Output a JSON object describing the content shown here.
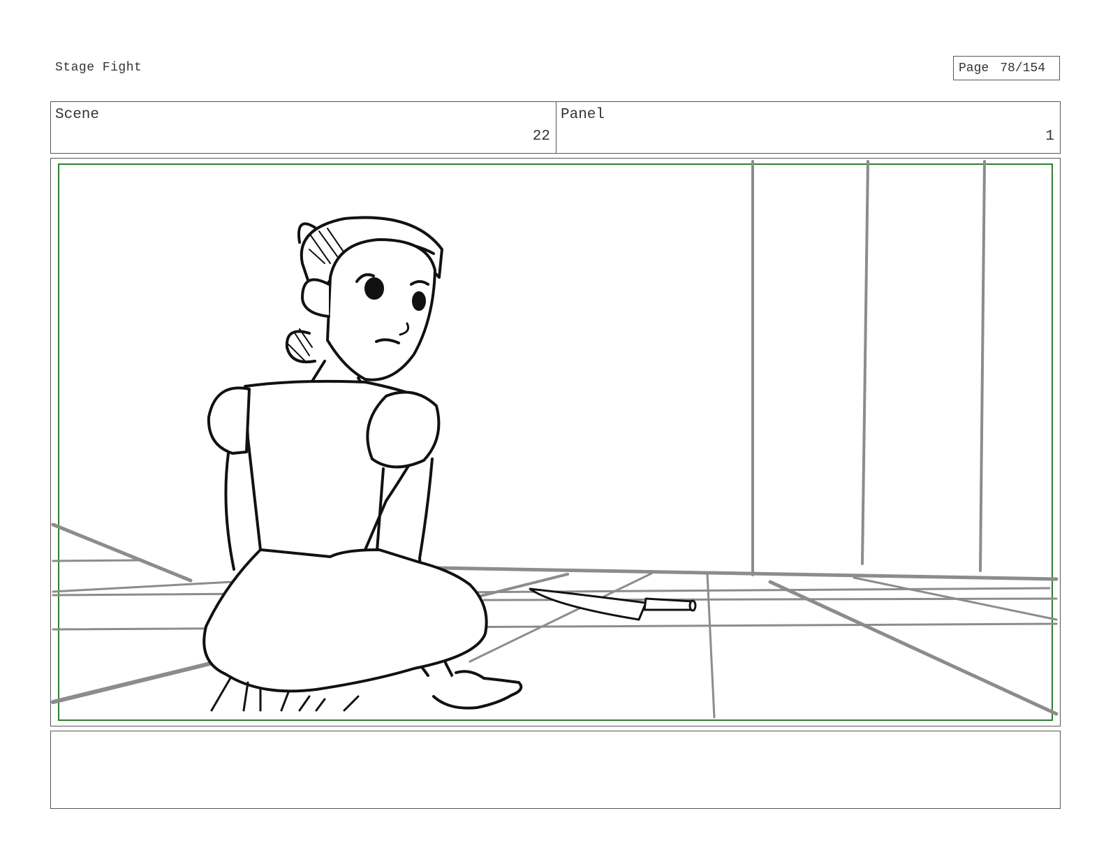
{
  "document": {
    "title": "Stage Fight",
    "page_label": "Page",
    "page_value": "78/154"
  },
  "header": {
    "scene_label": "Scene",
    "scene_value": "22",
    "panel_label": "Panel",
    "panel_value": "1"
  },
  "notes": {
    "text": ""
  },
  "colors": {
    "safe_frame": "#2e7d32",
    "sketch_gray": "#8c8c8c",
    "ink": "#111111"
  }
}
